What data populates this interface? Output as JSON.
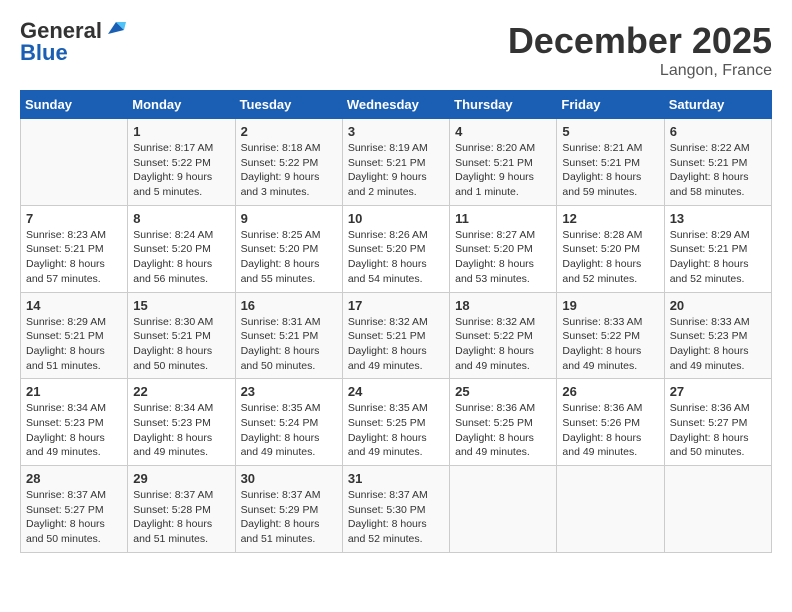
{
  "logo": {
    "general": "General",
    "blue": "Blue"
  },
  "header": {
    "month": "December 2025",
    "location": "Langon, France"
  },
  "columns": [
    "Sunday",
    "Monday",
    "Tuesday",
    "Wednesday",
    "Thursday",
    "Friday",
    "Saturday"
  ],
  "weeks": [
    [
      {
        "day": "",
        "sunrise": "",
        "sunset": "",
        "daylight": ""
      },
      {
        "day": "1",
        "sunrise": "Sunrise: 8:17 AM",
        "sunset": "Sunset: 5:22 PM",
        "daylight": "Daylight: 9 hours and 5 minutes."
      },
      {
        "day": "2",
        "sunrise": "Sunrise: 8:18 AM",
        "sunset": "Sunset: 5:22 PM",
        "daylight": "Daylight: 9 hours and 3 minutes."
      },
      {
        "day": "3",
        "sunrise": "Sunrise: 8:19 AM",
        "sunset": "Sunset: 5:21 PM",
        "daylight": "Daylight: 9 hours and 2 minutes."
      },
      {
        "day": "4",
        "sunrise": "Sunrise: 8:20 AM",
        "sunset": "Sunset: 5:21 PM",
        "daylight": "Daylight: 9 hours and 1 minute."
      },
      {
        "day": "5",
        "sunrise": "Sunrise: 8:21 AM",
        "sunset": "Sunset: 5:21 PM",
        "daylight": "Daylight: 8 hours and 59 minutes."
      },
      {
        "day": "6",
        "sunrise": "Sunrise: 8:22 AM",
        "sunset": "Sunset: 5:21 PM",
        "daylight": "Daylight: 8 hours and 58 minutes."
      }
    ],
    [
      {
        "day": "7",
        "sunrise": "Sunrise: 8:23 AM",
        "sunset": "Sunset: 5:21 PM",
        "daylight": "Daylight: 8 hours and 57 minutes."
      },
      {
        "day": "8",
        "sunrise": "Sunrise: 8:24 AM",
        "sunset": "Sunset: 5:20 PM",
        "daylight": "Daylight: 8 hours and 56 minutes."
      },
      {
        "day": "9",
        "sunrise": "Sunrise: 8:25 AM",
        "sunset": "Sunset: 5:20 PM",
        "daylight": "Daylight: 8 hours and 55 minutes."
      },
      {
        "day": "10",
        "sunrise": "Sunrise: 8:26 AM",
        "sunset": "Sunset: 5:20 PM",
        "daylight": "Daylight: 8 hours and 54 minutes."
      },
      {
        "day": "11",
        "sunrise": "Sunrise: 8:27 AM",
        "sunset": "Sunset: 5:20 PM",
        "daylight": "Daylight: 8 hours and 53 minutes."
      },
      {
        "day": "12",
        "sunrise": "Sunrise: 8:28 AM",
        "sunset": "Sunset: 5:20 PM",
        "daylight": "Daylight: 8 hours and 52 minutes."
      },
      {
        "day": "13",
        "sunrise": "Sunrise: 8:29 AM",
        "sunset": "Sunset: 5:21 PM",
        "daylight": "Daylight: 8 hours and 52 minutes."
      }
    ],
    [
      {
        "day": "14",
        "sunrise": "Sunrise: 8:29 AM",
        "sunset": "Sunset: 5:21 PM",
        "daylight": "Daylight: 8 hours and 51 minutes."
      },
      {
        "day": "15",
        "sunrise": "Sunrise: 8:30 AM",
        "sunset": "Sunset: 5:21 PM",
        "daylight": "Daylight: 8 hours and 50 minutes."
      },
      {
        "day": "16",
        "sunrise": "Sunrise: 8:31 AM",
        "sunset": "Sunset: 5:21 PM",
        "daylight": "Daylight: 8 hours and 50 minutes."
      },
      {
        "day": "17",
        "sunrise": "Sunrise: 8:32 AM",
        "sunset": "Sunset: 5:21 PM",
        "daylight": "Daylight: 8 hours and 49 minutes."
      },
      {
        "day": "18",
        "sunrise": "Sunrise: 8:32 AM",
        "sunset": "Sunset: 5:22 PM",
        "daylight": "Daylight: 8 hours and 49 minutes."
      },
      {
        "day": "19",
        "sunrise": "Sunrise: 8:33 AM",
        "sunset": "Sunset: 5:22 PM",
        "daylight": "Daylight: 8 hours and 49 minutes."
      },
      {
        "day": "20",
        "sunrise": "Sunrise: 8:33 AM",
        "sunset": "Sunset: 5:23 PM",
        "daylight": "Daylight: 8 hours and 49 minutes."
      }
    ],
    [
      {
        "day": "21",
        "sunrise": "Sunrise: 8:34 AM",
        "sunset": "Sunset: 5:23 PM",
        "daylight": "Daylight: 8 hours and 49 minutes."
      },
      {
        "day": "22",
        "sunrise": "Sunrise: 8:34 AM",
        "sunset": "Sunset: 5:23 PM",
        "daylight": "Daylight: 8 hours and 49 minutes."
      },
      {
        "day": "23",
        "sunrise": "Sunrise: 8:35 AM",
        "sunset": "Sunset: 5:24 PM",
        "daylight": "Daylight: 8 hours and 49 minutes."
      },
      {
        "day": "24",
        "sunrise": "Sunrise: 8:35 AM",
        "sunset": "Sunset: 5:25 PM",
        "daylight": "Daylight: 8 hours and 49 minutes."
      },
      {
        "day": "25",
        "sunrise": "Sunrise: 8:36 AM",
        "sunset": "Sunset: 5:25 PM",
        "daylight": "Daylight: 8 hours and 49 minutes."
      },
      {
        "day": "26",
        "sunrise": "Sunrise: 8:36 AM",
        "sunset": "Sunset: 5:26 PM",
        "daylight": "Daylight: 8 hours and 49 minutes."
      },
      {
        "day": "27",
        "sunrise": "Sunrise: 8:36 AM",
        "sunset": "Sunset: 5:27 PM",
        "daylight": "Daylight: 8 hours and 50 minutes."
      }
    ],
    [
      {
        "day": "28",
        "sunrise": "Sunrise: 8:37 AM",
        "sunset": "Sunset: 5:27 PM",
        "daylight": "Daylight: 8 hours and 50 minutes."
      },
      {
        "day": "29",
        "sunrise": "Sunrise: 8:37 AM",
        "sunset": "Sunset: 5:28 PM",
        "daylight": "Daylight: 8 hours and 51 minutes."
      },
      {
        "day": "30",
        "sunrise": "Sunrise: 8:37 AM",
        "sunset": "Sunset: 5:29 PM",
        "daylight": "Daylight: 8 hours and 51 minutes."
      },
      {
        "day": "31",
        "sunrise": "Sunrise: 8:37 AM",
        "sunset": "Sunset: 5:30 PM",
        "daylight": "Daylight: 8 hours and 52 minutes."
      },
      {
        "day": "",
        "sunrise": "",
        "sunset": "",
        "daylight": ""
      },
      {
        "day": "",
        "sunrise": "",
        "sunset": "",
        "daylight": ""
      },
      {
        "day": "",
        "sunrise": "",
        "sunset": "",
        "daylight": ""
      }
    ]
  ]
}
